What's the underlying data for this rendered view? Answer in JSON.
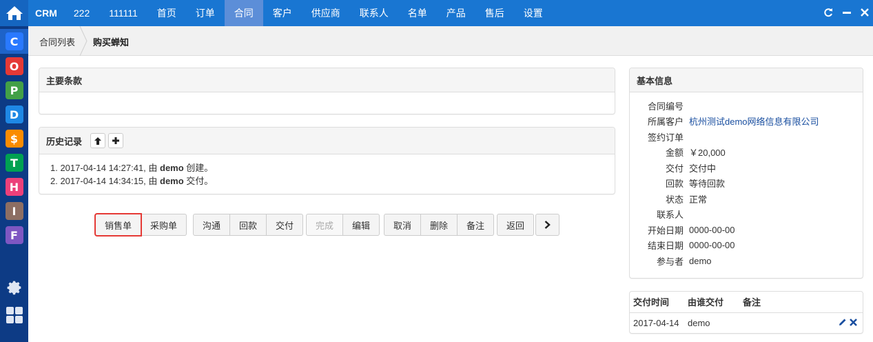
{
  "topnav": {
    "brand": "CRM",
    "items": [
      "222",
      "111111",
      "首页",
      "订单",
      "合同",
      "客户",
      "供应商",
      "联系人",
      "名单",
      "产品",
      "售后",
      "设置"
    ],
    "active": "合同"
  },
  "appbar": {
    "apps": [
      {
        "letter": "C",
        "color": "#2979ff"
      },
      {
        "letter": "O",
        "color": "#e53935"
      },
      {
        "letter": "P",
        "color": "#43a047"
      },
      {
        "letter": "D",
        "color": "#1e88e5"
      },
      {
        "letter": "$",
        "color": "#fb8c00"
      },
      {
        "letter": "T",
        "color": "#00a152"
      },
      {
        "letter": "H",
        "color": "#ec407a"
      },
      {
        "letter": "I",
        "color": "#8d6e63"
      },
      {
        "letter": "F",
        "color": "#7e57c2"
      }
    ]
  },
  "breadcrumb": {
    "parent": "合同列表",
    "current": "购买蝉知"
  },
  "main_terms": {
    "title": "主要条款"
  },
  "history": {
    "title": "历史记录",
    "entries": [
      {
        "prefix": "1. 2017-04-14 14:27:41, 由 ",
        "actor": "demo",
        "action": " 创建。"
      },
      {
        "prefix": "2. 2017-04-14 14:34:15, 由 ",
        "actor": "demo",
        "action": " 交付。"
      }
    ]
  },
  "actions": {
    "sales_order": "销售单",
    "purchase_order": "采购单",
    "communicate": "沟通",
    "payment": "回款",
    "deliver": "交付",
    "finish": "完成",
    "edit": "编辑",
    "cancel": "取消",
    "delete": "删除",
    "note": "备注",
    "back": "返回"
  },
  "basic_info": {
    "title": "基本信息",
    "rows": [
      {
        "label": "合同编号",
        "value": ""
      },
      {
        "label": "所属客户",
        "value": "杭州测试demo网络信息有限公司"
      },
      {
        "label": "签约订单",
        "value": ""
      },
      {
        "label": "金额",
        "value": "￥20,000"
      },
      {
        "label": "交付",
        "value": "交付中"
      },
      {
        "label": "回款",
        "value": "等待回款"
      },
      {
        "label": "状态",
        "value": "正常"
      },
      {
        "label": "联系人",
        "value": ""
      },
      {
        "label": "开始日期",
        "value": "0000-00-00"
      },
      {
        "label": "结束日期",
        "value": "0000-00-00"
      },
      {
        "label": "参与者",
        "value": "demo"
      }
    ]
  },
  "delivery": {
    "headers": [
      "交付时间",
      "由谁交付",
      "备注"
    ],
    "rows": [
      {
        "time": "2017-04-14",
        "by": "demo",
        "note": ""
      }
    ]
  },
  "colors": {
    "nav": "#1976d2",
    "appbar": "#0d3b85",
    "link": "#1a4fa0",
    "highlight": "#e53935"
  }
}
